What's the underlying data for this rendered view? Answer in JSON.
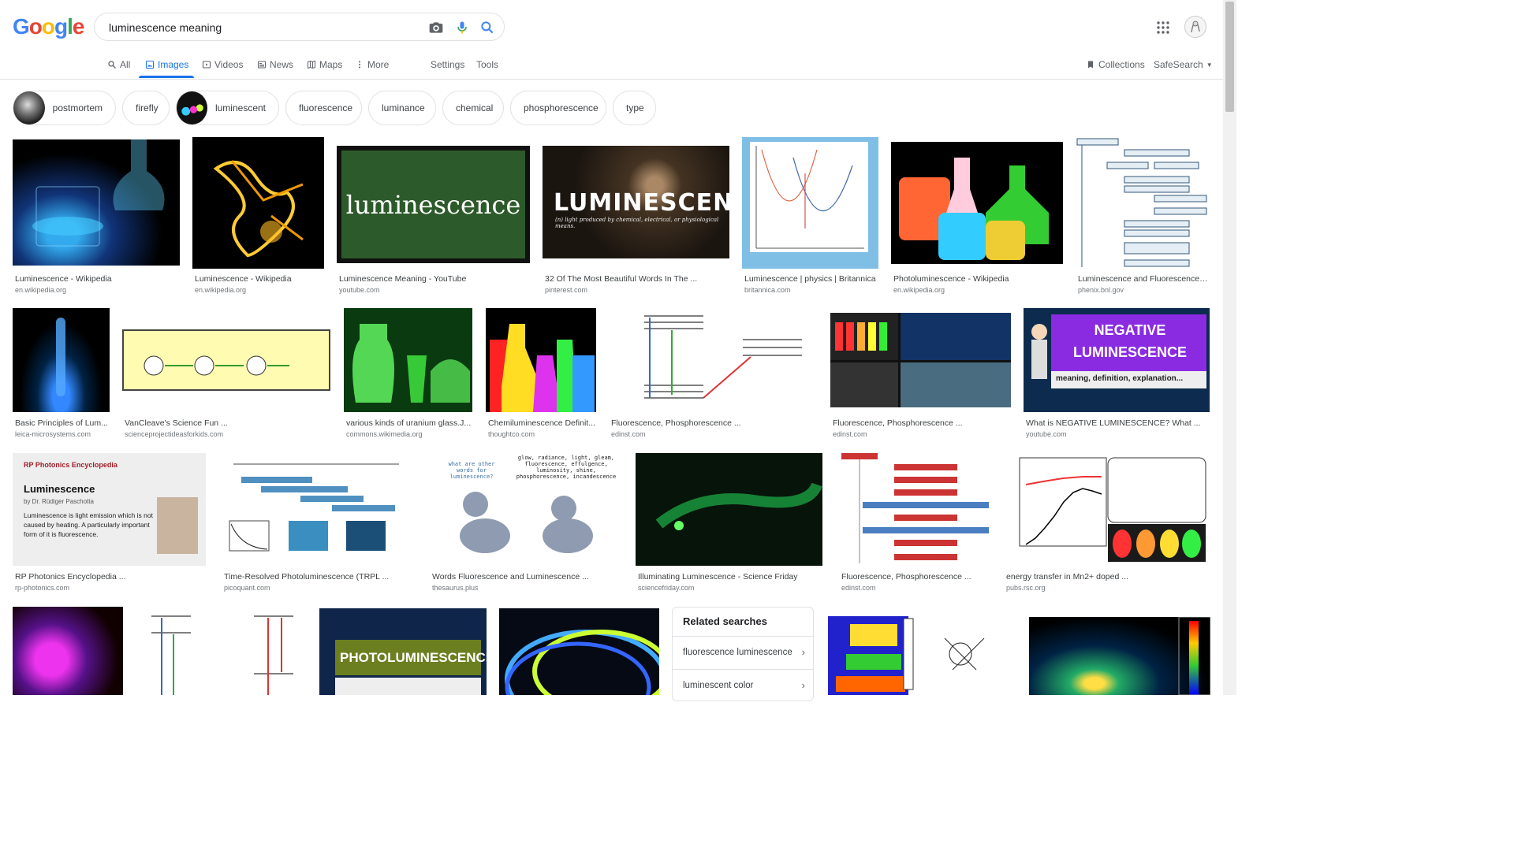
{
  "logo": {
    "letters": [
      "G",
      "o",
      "o",
      "g",
      "l",
      "e"
    ],
    "colors": [
      "#4285f4",
      "#ea4335",
      "#fbbc05",
      "#4285f4",
      "#34a853",
      "#ea4335"
    ]
  },
  "search": {
    "value": "luminescence meaning",
    "icons": [
      "camera-icon",
      "microphone-icon",
      "search-icon"
    ]
  },
  "header_right": {
    "icons": [
      "apps-grid-icon",
      "account-avatar"
    ]
  },
  "tabs": [
    {
      "label": "All",
      "icon": "search-icon",
      "active": false
    },
    {
      "label": "Images",
      "icon": "image-icon",
      "active": true
    },
    {
      "label": "Videos",
      "icon": "video-icon",
      "active": false
    },
    {
      "label": "News",
      "icon": "news-icon",
      "active": false
    },
    {
      "label": "Maps",
      "icon": "map-icon",
      "active": false
    },
    {
      "label": "More",
      "icon": "more-vert-icon",
      "active": false
    }
  ],
  "tools": {
    "settings": "Settings",
    "tools": "Tools",
    "collections": "Collections",
    "safesearch": "SafeSearch"
  },
  "chips": [
    {
      "label": "postmortem",
      "thumb": true
    },
    {
      "label": "firefly",
      "thumb": false
    },
    {
      "label": "luminescent",
      "thumb": true
    },
    {
      "label": "fluorescence",
      "thumb": false
    },
    {
      "label": "luminance",
      "thumb": false
    },
    {
      "label": "chemical",
      "thumb": false
    },
    {
      "label": "phosphorescence",
      "thumb": false
    },
    {
      "label": "type",
      "thumb": false
    }
  ],
  "results": [
    {
      "title": "Luminescence - Wikipedia",
      "source": "en.wikipedia.org"
    },
    {
      "title": "Luminescence - Wikipedia",
      "source": "en.wikipedia.org"
    },
    {
      "title": "Luminescence Meaning - YouTube",
      "source": "youtube.com",
      "image_text": "luminescence"
    },
    {
      "title": "32 Of The Most Beautiful Words In The ...",
      "source": "pinterest.com",
      "image_text": "LUMINESCENCE",
      "image_subtext": "(n) light produced by chemical, electrical, or physiological means."
    },
    {
      "title": "Luminescence | physics | Britannica",
      "source": "britannica.com"
    },
    {
      "title": "Photoluminescence - Wikipedia",
      "source": "en.wikipedia.org"
    },
    {
      "title": "Luminescence and Fluorescence ...",
      "source": "phenix.bnl.gov"
    },
    {
      "title": "Basic Principles of Lum...",
      "source": "leica-microsystems.com"
    },
    {
      "title": "VanCleave's Science Fun ...",
      "source": "scienceprojectideasforkids.com"
    },
    {
      "title": "various kinds of uranium glass.J...",
      "source": "commons.wikimedia.org"
    },
    {
      "title": "Chemiluminescence Definit...",
      "source": "thoughtco.com"
    },
    {
      "title": "Fluorescence, Phosphorescence ...",
      "source": "edinst.com"
    },
    {
      "title": "Fluorescence, Phosphorescence ...",
      "source": "edinst.com"
    },
    {
      "title": "What is NEGATIVE LUMINESCENCE? What ...",
      "source": "youtube.com",
      "image_text": [
        "NEGATIVE",
        "LUMINESCENCE",
        "meaning, definition, explanation..."
      ]
    },
    {
      "title": "RP Photonics Encyclopedia ...",
      "source": "rp-photonics.com",
      "image_text": {
        "brand": "RP Photonics Encyclopedia",
        "heading": "Luminescence",
        "byline": "by Dr. Rüdiger Paschotta",
        "body": "Luminescence is light emission which is not caused by heating. A particularly important form of it is fluorescence."
      }
    },
    {
      "title": "Time-Resolved Photoluminescence (TRPL ...",
      "source": "picoquant.com"
    },
    {
      "title": "Words Fluorescence and Luminescence ...",
      "source": "thesaurus.plus",
      "image_text": [
        "what are other words for luminescence?",
        "glow, radiance, light, gleam, fluorescence, effulgence, luminosity, shine, phosphorescence, incandescence"
      ]
    },
    {
      "title": "Illuminating Luminescence - Science Friday",
      "source": "sciencefriday.com"
    },
    {
      "title": "Fluorescence, Phosphorescence ...",
      "source": "edinst.com"
    },
    {
      "title": "energy transfer in Mn2+ doped ...",
      "source": "pubs.rsc.org"
    },
    {
      "title": "",
      "source": ""
    },
    {
      "title": "",
      "source": ""
    },
    {
      "title": "",
      "source": "",
      "image_text": "PHOTOLUMINESCENCE"
    },
    {
      "title": "",
      "source": ""
    },
    {
      "title": "",
      "source": ""
    },
    {
      "title": "",
      "source": ""
    }
  ],
  "related": {
    "heading": "Related searches",
    "items": [
      "fluorescence luminescence",
      "luminescent color"
    ]
  }
}
